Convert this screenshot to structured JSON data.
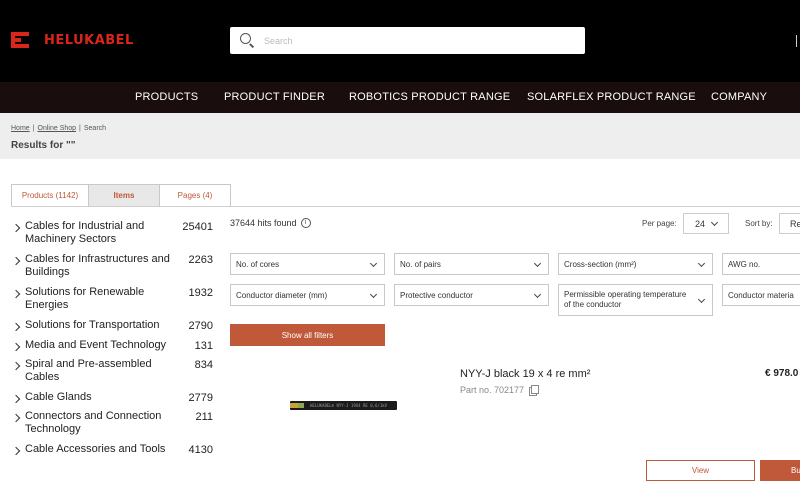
{
  "brand": {
    "name": "HELUKABEL",
    "color": "#d9251c"
  },
  "search": {
    "placeholder": "Search",
    "value": ""
  },
  "nav": {
    "items": [
      {
        "label": "PRODUCTS"
      },
      {
        "label": "PRODUCT FINDER"
      },
      {
        "label": "ROBOTICS PRODUCT RANGE"
      },
      {
        "label": "SOLARFLEX PRODUCT RANGE"
      },
      {
        "label": "COMPANY"
      }
    ]
  },
  "breadcrumb": {
    "home": "Home",
    "shop": "Online Shop",
    "current": "Search",
    "separator": "|"
  },
  "results_title": "Results for \"\"",
  "tabs": [
    {
      "label": "Products (1142)",
      "active": false
    },
    {
      "label": "Items",
      "active": true
    },
    {
      "label": "Pages (4)",
      "active": false
    }
  ],
  "categories": [
    {
      "name": "Cables for Industrial and Machinery Sectors",
      "count": "25401"
    },
    {
      "name": "Cables for Infrastructures and Buildings",
      "count": "2263"
    },
    {
      "name": "Solutions for Renewable Energies",
      "count": "1932"
    },
    {
      "name": "Solutions for Transportation",
      "count": "2790"
    },
    {
      "name": "Media and Event Technology",
      "count": "131"
    },
    {
      "name": "Spiral and Pre-assembled Cables",
      "count": "834"
    },
    {
      "name": "Cable Glands",
      "count": "2779"
    },
    {
      "name": "Connectors and Connection Technology",
      "count": "211"
    },
    {
      "name": "Cable Accessories and Tools",
      "count": "4130"
    }
  ],
  "results": {
    "hits": "37644 hits found",
    "per_page_label": "Per page:",
    "per_page_value": "24",
    "sort_label": "Sort by:",
    "sort_value": "Re"
  },
  "filters": [
    {
      "label": "No. of cores"
    },
    {
      "label": "No. of pairs"
    },
    {
      "label": "Cross-section (mm²)"
    },
    {
      "label": "AWG no."
    },
    {
      "label": "Conductor diameter (mm)"
    },
    {
      "label": "Protective conductor"
    },
    {
      "label": "Permissible operating temperature of the conductor"
    },
    {
      "label": "Conductor materia"
    }
  ],
  "show_filters_label": "Show all filters",
  "product": {
    "name": "NYY-J black 19 x 4 re mm²",
    "part_no": "Part no. 702177",
    "price": "€ 978.0",
    "cable_print": "HELUKABEL® NYY-J 19X4 RE 0,6/1kV",
    "view_label": "View",
    "buy_label": "Bu"
  },
  "colors": {
    "accent": "#c0583a",
    "topbar": "#000000",
    "nav": "#1a0d0d"
  }
}
